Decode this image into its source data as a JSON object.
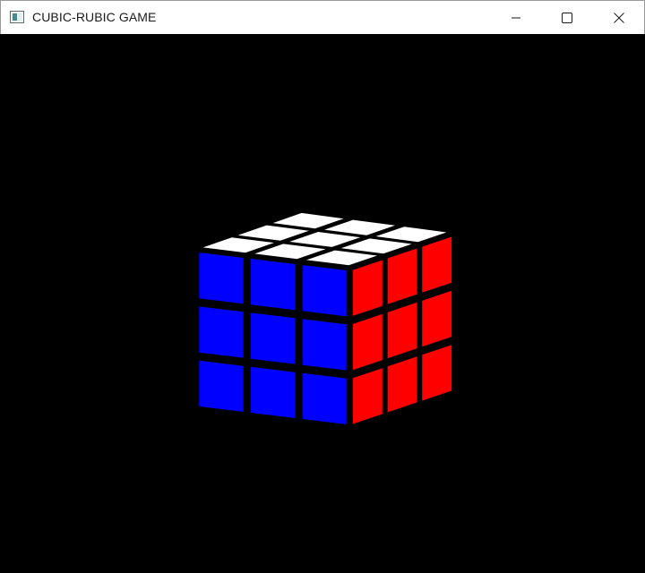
{
  "window": {
    "title": "CUBIC-RUBIC GAME",
    "controls": {
      "minimize_icon": "minimize-icon",
      "maximize_icon": "maximize-icon",
      "close_icon": "close-icon"
    }
  },
  "game": {
    "background": "#000000",
    "cube": {
      "size": 3,
      "faces": {
        "top": {
          "color": "#ffffff",
          "stickers": [
            [
              "white",
              "white",
              "white"
            ],
            [
              "white",
              "white",
              "white"
            ],
            [
              "white",
              "white",
              "white"
            ]
          ]
        },
        "front": {
          "color": "#0000ff",
          "stickers": [
            [
              "blue",
              "blue",
              "blue"
            ],
            [
              "blue",
              "blue",
              "blue"
            ],
            [
              "blue",
              "blue",
              "blue"
            ]
          ]
        },
        "right": {
          "color": "#ff0000",
          "stickers": [
            [
              "red",
              "red",
              "red"
            ],
            [
              "red",
              "red",
              "red"
            ],
            [
              "red",
              "red",
              "red"
            ]
          ]
        }
      },
      "palette": {
        "white": "#ffffff",
        "blue": "#0000ff",
        "red": "#ff0000"
      }
    }
  }
}
